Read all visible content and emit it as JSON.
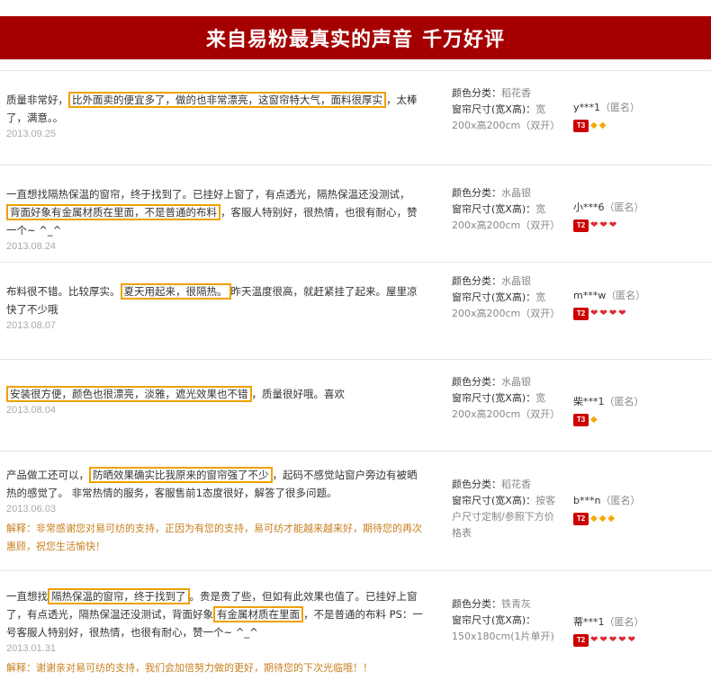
{
  "banner": {
    "title": "来自易粉最真实的声音",
    "subtitle": "千万好评"
  },
  "reviews": [
    {
      "segments": [
        {
          "t": "质量非常好，",
          "h": false
        },
        {
          "t": "比外面卖的便宜多了，做的也非常漂亮，这窗帘特大气，面料很厚实",
          "h": true
        },
        {
          "t": "，太棒了，满意。。",
          "h": false
        }
      ],
      "date": "2013.09.25",
      "reply": "",
      "color_label": "颜色分类：",
      "color": "稻花香",
      "size_label": "窗帘尺寸(宽X高)：",
      "size": "宽200x高200cm（双开）",
      "user": "y***1",
      "anon": "（匿名）",
      "level": "T3",
      "gems": [
        "gold",
        "gold"
      ]
    },
    {
      "segments": [
        {
          "t": "一直想找隔热保温的窗帘，终于找到了。已挂好上窗了，有点透光，隔热保温还没测试，",
          "h": false
        },
        {
          "t": "背面好象有金属材质在里面，不是普通的布料",
          "h": true
        },
        {
          "t": "，客服人特别好，很热情，也很有耐心，赞一个~ ^_^",
          "h": false
        }
      ],
      "date": "2013.08.24",
      "reply": "",
      "color_label": "颜色分类：",
      "color": "水晶银",
      "size_label": "窗帘尺寸(宽X高)：",
      "size": "宽200x高200cm（双开）",
      "user": "小***6",
      "anon": "（匿名）",
      "level": "T2",
      "gems": [
        "red",
        "red",
        "red"
      ]
    },
    {
      "segments": [
        {
          "t": "布料很不错。比较厚实。",
          "h": false
        },
        {
          "t": "夏天用起来，很隔热。",
          "h": true
        },
        {
          "t": "昨天温度很高，就赶紧挂了起来。屋里凉快了不少哦",
          "h": false
        }
      ],
      "date": "2013.08.07",
      "reply": "",
      "color_label": "颜色分类：",
      "color": "水晶银",
      "size_label": "窗帘尺寸(宽X高)：",
      "size": "宽200x高200cm（双开）",
      "user": "m***w",
      "anon": "（匿名）",
      "level": "T2",
      "gems": [
        "red",
        "red",
        "red",
        "red"
      ]
    },
    {
      "segments": [
        {
          "t": "安装很方便，颜色也很漂亮，淡雅，遮光效果也不错",
          "h": true
        },
        {
          "t": "，质量很好哦。喜欢",
          "h": false
        }
      ],
      "date": "2013.08.04",
      "reply": "",
      "color_label": "颜色分类：",
      "color": "水晶银",
      "size_label": "窗帘尺寸(宽X高)：",
      "size": "宽200x高200cm（双开）",
      "user": "柴***1",
      "anon": "（匿名）",
      "level": "T3",
      "gems": [
        "gold"
      ]
    },
    {
      "segments": [
        {
          "t": "产品做工还可以，",
          "h": false
        },
        {
          "t": "防晒效果确实比我原来的窗帘强了不少",
          "h": true
        },
        {
          "t": "，起码不感觉站窗户旁边有被晒热的感觉了。 非常热情的服务，客服售前1态度很好，解答了很多问题。",
          "h": false
        }
      ],
      "date": "2013.06.03",
      "reply": "解释：非常感谢您对易可纺的支持，正因为有您的支持，易可纺才能越来越来好，期待您的再次惠顾，祝您生活愉快！",
      "color_label": "颜色分类：",
      "color": "稻花香",
      "size_label": "窗帘尺寸(宽X高)：",
      "size": "按客户尺寸定制/参照下方价格表",
      "user": "b***n",
      "anon": "（匿名）",
      "level": "T2",
      "gems": [
        "gold",
        "gold",
        "gold"
      ]
    },
    {
      "segments": [
        {
          "t": "一直想找",
          "h": false
        },
        {
          "t": "隔热保温的窗帘，终于找到了",
          "h": true
        },
        {
          "t": "。贵是贵了些，但如有此效果也值了。已挂好上窗了，有点透光，隔热保温还没测试，背面好象",
          "h": false
        },
        {
          "t": "有金属材质在里面",
          "h": true
        },
        {
          "t": "，不是普通的布料 PS：一号客服人特别好，很热情，也很有耐心，赞一个~ ^_^",
          "h": false
        }
      ],
      "date": "2013.01.31",
      "reply": "解释：谢谢亲对易可纺的支持，我们会加倍努力做的更好，期待您的下次光临哦！！",
      "color_label": "颜色分类：",
      "color": "铁青灰",
      "size_label": "窗帘尺寸(宽X高)：",
      "size": "150x180cm(1片单开)",
      "user": "蒂***1",
      "anon": "（匿名）",
      "level": "T2",
      "gems": [
        "red",
        "red",
        "red",
        "red",
        "red"
      ]
    }
  ]
}
